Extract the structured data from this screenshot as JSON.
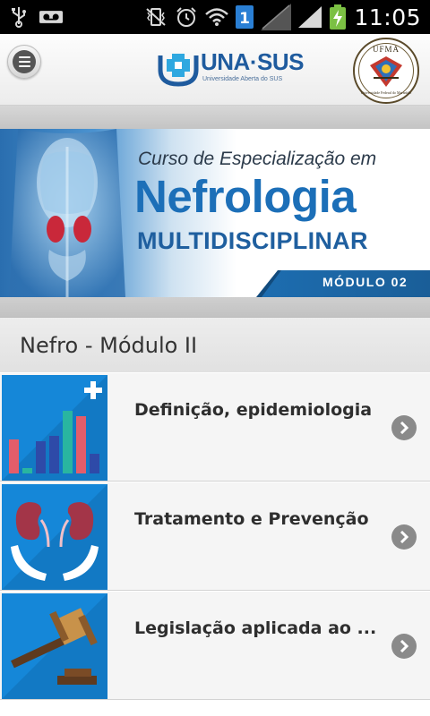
{
  "status_bar": {
    "time": "11:05",
    "sim_badge": "1",
    "icons": [
      "usb-icon",
      "voicemail-icon",
      "vibrate-icon",
      "alarm-icon",
      "wifi-icon",
      "sim-icon",
      "signal-icon",
      "battery-charging-icon"
    ]
  },
  "header": {
    "menu_icon": "menu-icon",
    "logo_name": "UNA·SUS",
    "logo_subtitle": "Universidade Aberta do SUS",
    "seal_text": "UFMA",
    "seal_subtitle": "Universidade Federal do Maranhão"
  },
  "banner": {
    "line1": "Curso de Especialização em",
    "line2": "Nefrologia",
    "line3": "MULTIDISCIPLINAR",
    "module": "MÓDULO 02"
  },
  "section": {
    "title": "Nefro - Módulo II"
  },
  "items": [
    {
      "label": "Definição, epidemiologia",
      "icon": "bar-chart-health-icon"
    },
    {
      "label": "Tratamento e Prevenção",
      "icon": "kidneys-hands-icon"
    },
    {
      "label": "Legislação aplicada ao ...",
      "icon": "gavel-icon"
    }
  ],
  "colors": {
    "accent": "#1587d8",
    "brand": "#1c6fb8",
    "chevron": "#8a8a8a"
  }
}
